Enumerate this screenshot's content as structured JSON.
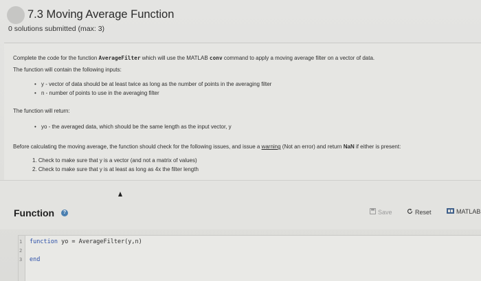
{
  "header": {
    "title": "7.3 Moving Average Function",
    "subtitle": "0 solutions submitted (max: 3)"
  },
  "description": {
    "intro_pre": "Complete the code for the function ",
    "intro_func": "AverageFilter",
    "intro_mid": " which will use the MATLAB ",
    "intro_cmd": "conv",
    "intro_post": " command to apply a moving average filter on a vector of data.",
    "inputs_heading": "The function will contain the following inputs:",
    "inputs": [
      "y - vector of data should be at least twice as long as the number of points in the averaging filter",
      "n - number of points to use in the averaging filter"
    ],
    "returns_heading": "The function will return:",
    "returns": [
      "yo - the averaged data, which should be the same length as the input vector, y"
    ],
    "check_pre": "Before calculating the moving average, the function should check for the following issues, and issue a ",
    "check_warning": "warning",
    "check_mid": " (Not an error) and return ",
    "check_nan": "NaN",
    "check_post": " if either is present:",
    "checks": [
      "1. Check to make sure that y is a vector (and not a matrix of values)",
      "2. Check to make sure that y is at least as long as 4x the filter length"
    ]
  },
  "function_section": {
    "title": "Function",
    "help_icon": "?",
    "save_label": "Save",
    "reset_label": "Reset",
    "matlab_label": "MATLAB"
  },
  "editor": {
    "line_numbers": [
      "1",
      "2",
      "3"
    ],
    "line1_kw": "function",
    "line1_rest": " yo = AverageFilter(y,n)",
    "line2": "",
    "line3_kw": "end"
  }
}
